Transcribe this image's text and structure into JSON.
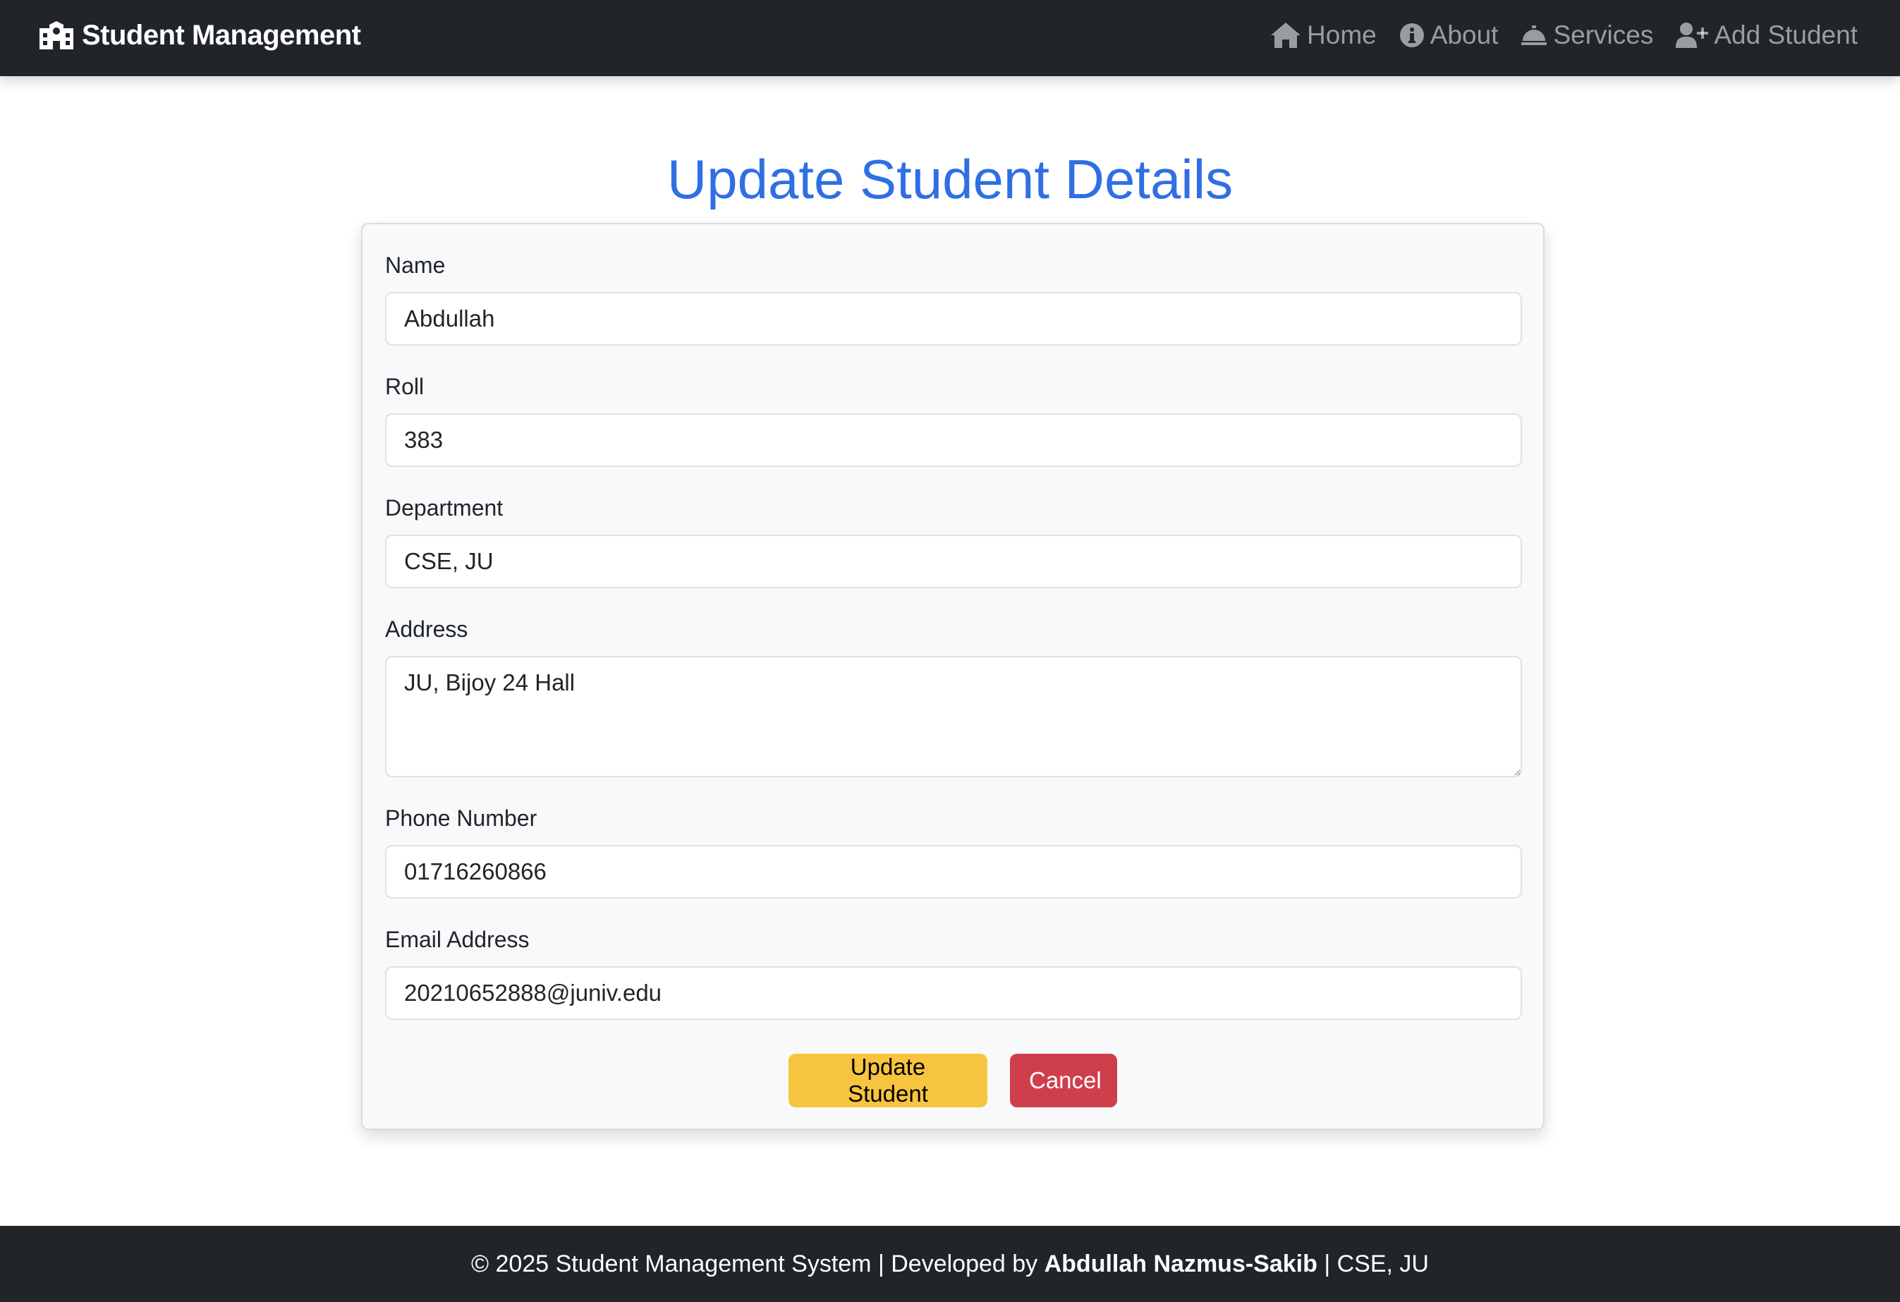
{
  "navbar": {
    "brand": "Student Management",
    "brand_icon": "school-icon",
    "links": [
      {
        "label": "Home",
        "icon": "home-icon"
      },
      {
        "label": "About",
        "icon": "info-circle-icon"
      },
      {
        "label": "Services",
        "icon": "bell-concierge-icon"
      },
      {
        "label": "Add Student",
        "icon": "user-plus-icon"
      }
    ]
  },
  "page": {
    "title": "Update Student Details"
  },
  "form": {
    "name": {
      "label": "Name",
      "value": "Abdullah"
    },
    "roll": {
      "label": "Roll",
      "value": "383"
    },
    "department": {
      "label": "Department",
      "value": "CSE, JU"
    },
    "address": {
      "label": "Address",
      "value": "JU, Bijoy 24 Hall"
    },
    "phone": {
      "label": "Phone Number",
      "value": "01716260866"
    },
    "email": {
      "label": "Email Address",
      "value": "20210652888@juniv.edu"
    },
    "update_label": "Update Student",
    "cancel_label": "Cancel"
  },
  "footer": {
    "prefix": "© 2025 Student Management System | Developed by ",
    "author": "Abdullah Nazmus-Sakib",
    "suffix": " | CSE, JU"
  },
  "colors": {
    "navbar_bg": "#212529",
    "title": "#2f6fe4",
    "update_button": "#f7c440",
    "cancel_button": "#cf3f4b",
    "card_bg": "#f8f9fa"
  }
}
